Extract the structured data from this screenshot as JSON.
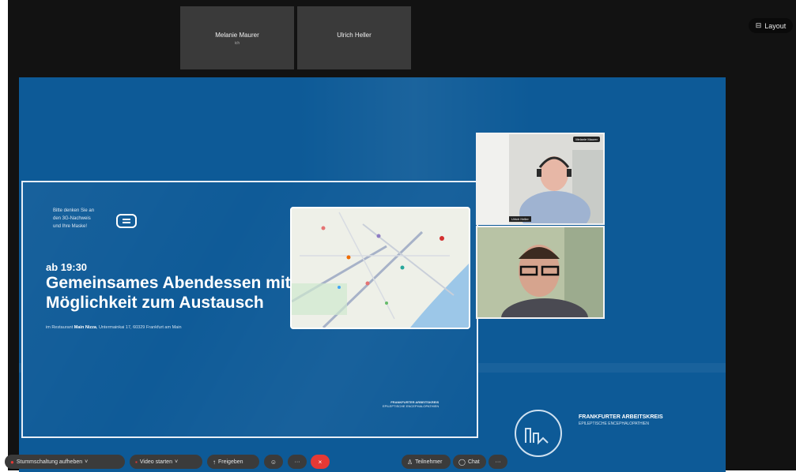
{
  "participants": [
    {
      "name": "Melanie Maurer",
      "sub": "ich"
    },
    {
      "name": "Ulrich Heller",
      "sub": ""
    }
  ],
  "layout_button": {
    "label": "Layout"
  },
  "slide": {
    "reminder_lines": [
      "Bitte denken Sie an",
      "den 3G-Nachweis",
      "und Ihre Maske!"
    ],
    "time": "ab 19:30",
    "title_line1": "Gemeinsames Abendessen mit",
    "title_line2": "Möglichkeit zum Austausch",
    "location_prefix": "im Restaurant",
    "location_name": "Main Nizza",
    "location_address": ", Untermainkai 17, 60329 Frankfurt am Main",
    "card_logo_line1": "FRANKFURTER ARBEITSKREIS",
    "card_logo_line2": "EPILEPTISCHE ENCEPHALOPATHIEN",
    "brand_line1": "FRANKFURTER ARBEITSKREIS",
    "brand_line2": "EPILEPTISCHE ENCEPHALOPATHIEN"
  },
  "videos": [
    {
      "name": "Ulrich Heller",
      "tag": "Melanie Maurer"
    },
    {
      "name": "",
      "tag": ""
    }
  ],
  "toolbar": {
    "mute_label": "Stummschaltung aufheben",
    "video_label": "Video starten",
    "share_label": "Freigeben",
    "more_label": "···",
    "end_icon": "×",
    "participants_label": "Teilnehmer",
    "chat_label": "Chat",
    "overflow_label": "···"
  },
  "colors": {
    "slide_blue": "#0d5a97",
    "end_red": "#e53935",
    "toolbar_gray": "#3b3b3b"
  }
}
